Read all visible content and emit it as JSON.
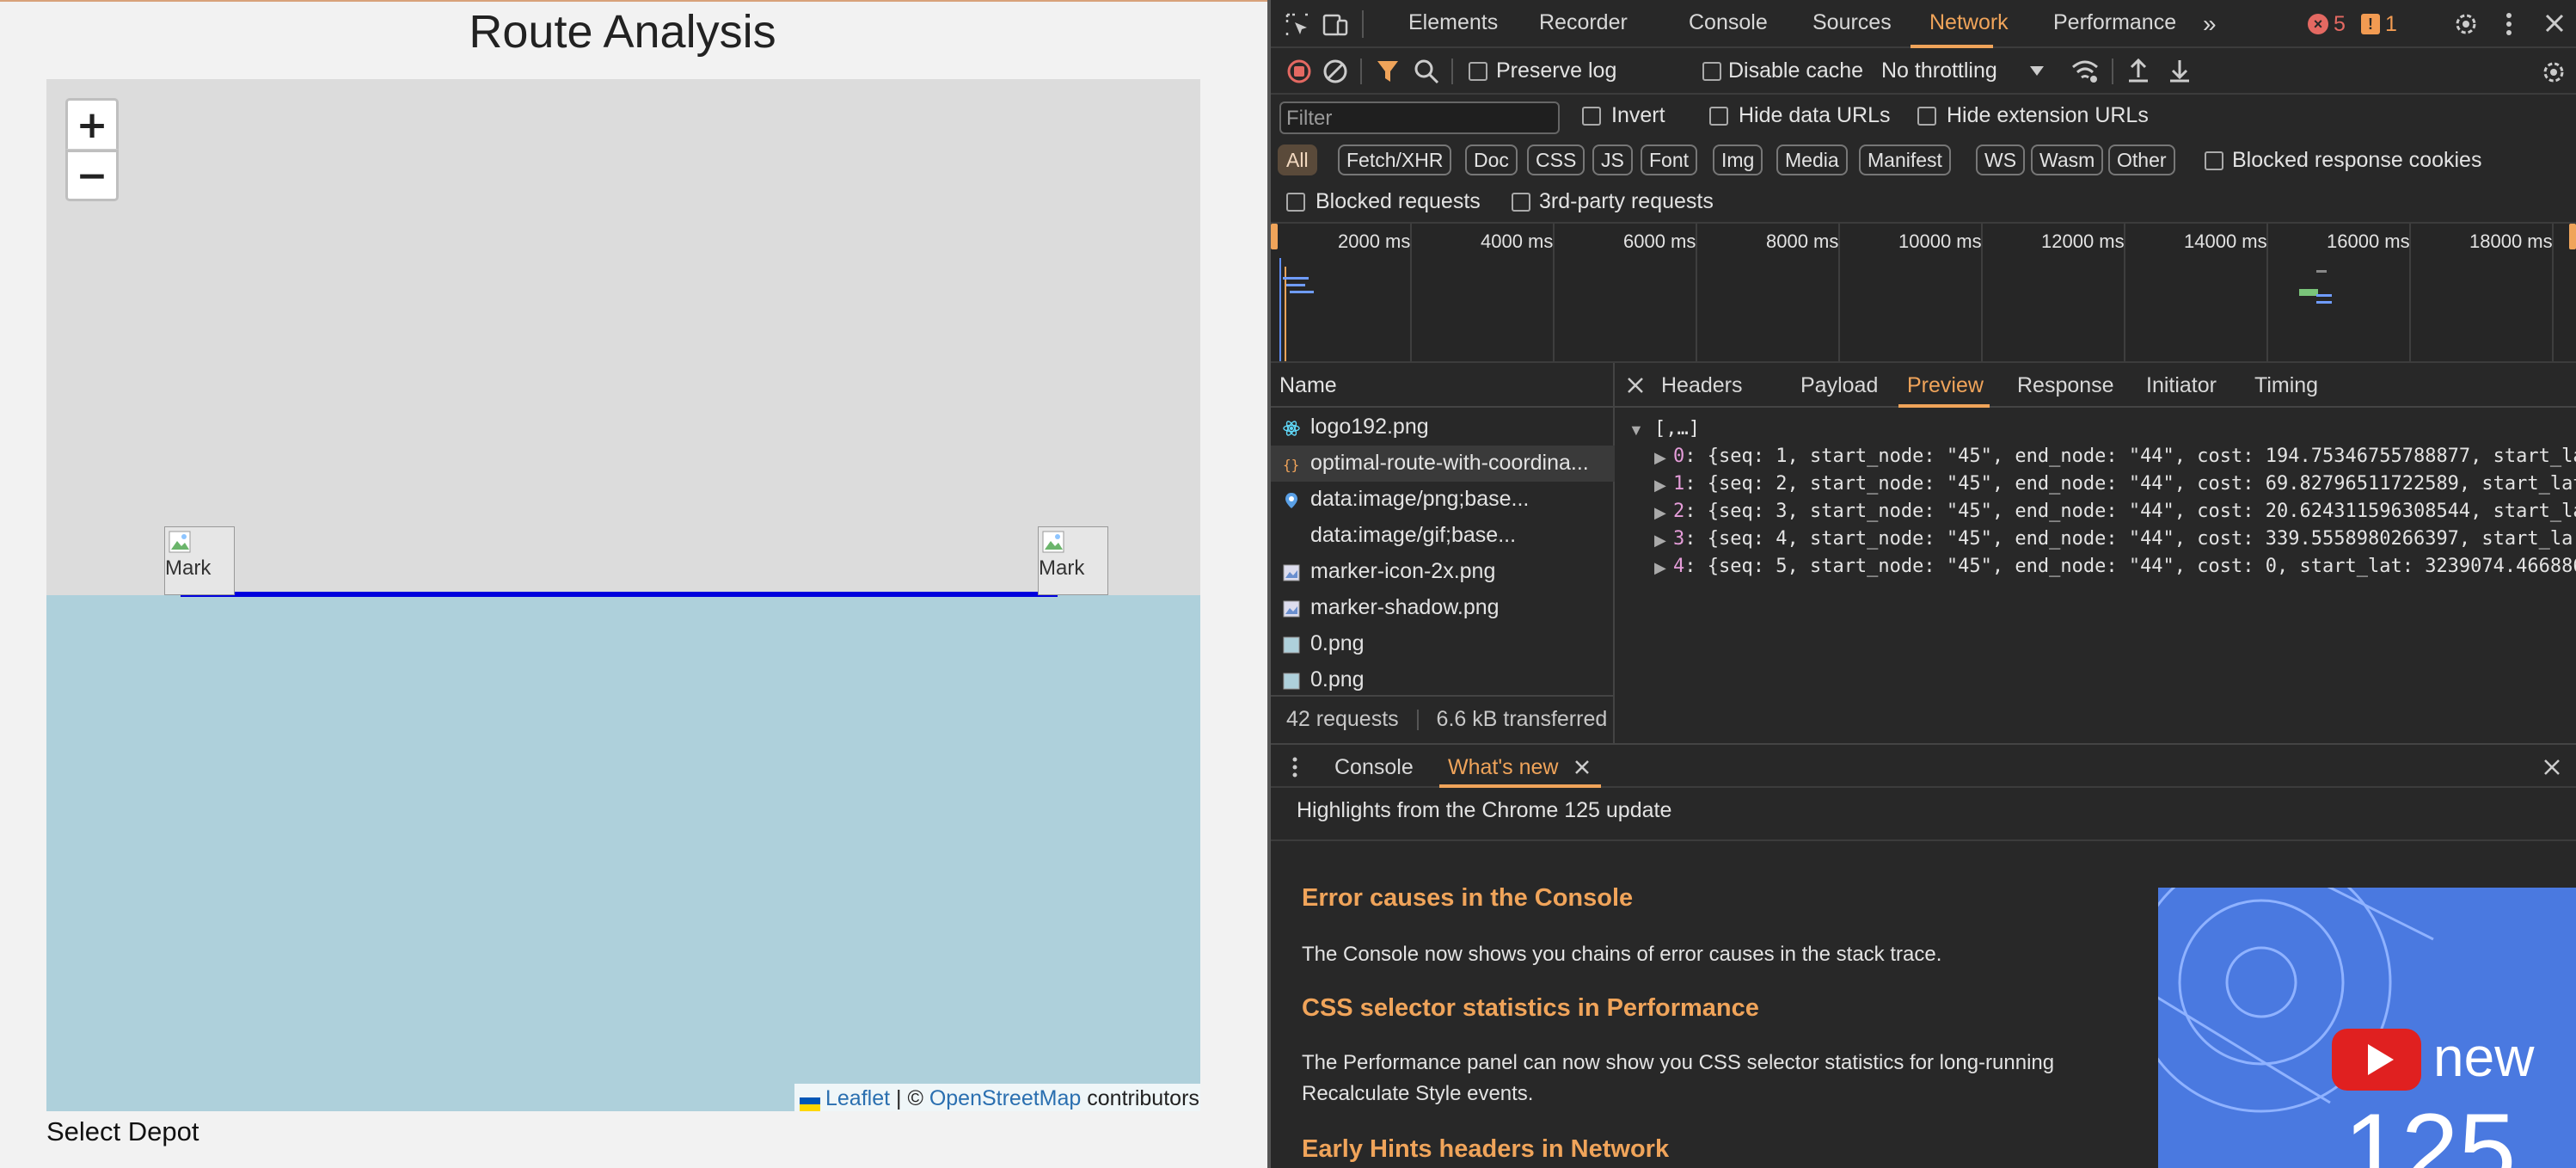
{
  "page": {
    "title": "Route Analysis",
    "depot_label": "Select Depot"
  },
  "map": {
    "zoom_in": "+",
    "zoom_out": "−",
    "marker_alt": "Mark",
    "attribution": {
      "leaflet": "Leaflet",
      "sep": " | © ",
      "osm": "OpenStreetMap",
      "contrib": " contributors"
    },
    "route_color": "#0000dd"
  },
  "devtools": {
    "tabs": [
      "Elements",
      "Recorder",
      "Console",
      "Sources",
      "Network",
      "Performance"
    ],
    "selected_tab": "Network",
    "error_count": "5",
    "warn_count": "1",
    "toolbar": {
      "preserve_log": "Preserve log",
      "disable_cache": "Disable cache",
      "throttling": "No throttling"
    },
    "filter": {
      "placeholder": "Filter",
      "invert": "Invert",
      "hide_data_urls": "Hide data URLs",
      "hide_extension_urls": "Hide extension URLs"
    },
    "types": [
      "All",
      "Fetch/XHR",
      "Doc",
      "CSS",
      "JS",
      "Font",
      "Img",
      "Media",
      "Manifest",
      "WS",
      "Wasm",
      "Other"
    ],
    "blocked_response_cookies": "Blocked response cookies",
    "blocked_requests": "Blocked requests",
    "third_party": "3rd-party requests",
    "timeline_ticks": [
      "2000 ms",
      "4000 ms",
      "6000 ms",
      "8000 ms",
      "10000 ms",
      "12000 ms",
      "14000 ms",
      "16000 ms",
      "18000 ms"
    ],
    "name_header": "Name",
    "requests": [
      {
        "name": "logo192.png",
        "icon": "react-icon"
      },
      {
        "name": "optimal-route-with-coordina...",
        "icon": "json-icon"
      },
      {
        "name": "data:image/png;base...",
        "icon": "pin-icon"
      },
      {
        "name": "data:image/gif;base...",
        "icon": ""
      },
      {
        "name": "marker-icon-2x.png",
        "icon": "image-icon"
      },
      {
        "name": "marker-shadow.png",
        "icon": "image-icon"
      },
      {
        "name": "0.png",
        "icon": "image-icon"
      },
      {
        "name": "0.png",
        "icon": "image-icon"
      }
    ],
    "summary": {
      "requests": "42 requests",
      "transferred": "6.6 kB transferred"
    },
    "detail_tabs": [
      "Headers",
      "Payload",
      "Preview",
      "Response",
      "Initiator",
      "Timing"
    ],
    "selected_detail_tab": "Preview",
    "preview": {
      "root": "[,…]",
      "items": [
        {
          "idx": "0",
          "text": "{seq: 1, start_node: \"45\", end_node: \"44\", cost: 194.75346755788877, start_la"
        },
        {
          "idx": "1",
          "text": "{seq: 2, start_node: \"45\", end_node: \"44\", cost: 69.82796511722589, start_lat"
        },
        {
          "idx": "2",
          "text": "{seq: 3, start_node: \"45\", end_node: \"44\", cost: 20.624311596308544, start_la"
        },
        {
          "idx": "3",
          "text": "{seq: 4, start_node: \"45\", end_node: \"44\", cost: 339.5558980266397, start_la"
        },
        {
          "idx": "4",
          "text": "{seq: 5, start_node: \"45\", end_node: \"44\", cost: 0, start_lat: 3239074.466886"
        }
      ]
    },
    "drawer": {
      "tabs": [
        "Console",
        "What's new"
      ],
      "selected": "What's new",
      "highlights": "Highlights from the Chrome 125 update",
      "sections": [
        {
          "title": "Error causes in the Console",
          "body": "The Console now shows you chains of error causes in the stack trace."
        },
        {
          "title": "CSS selector statistics in Performance",
          "body": "The Performance panel can now show you CSS selector statistics for long-running Recalculate Style events."
        },
        {
          "title": "Early Hints headers in Network",
          "body": ""
        }
      ],
      "video_new": "new",
      "video_num": "125"
    }
  }
}
